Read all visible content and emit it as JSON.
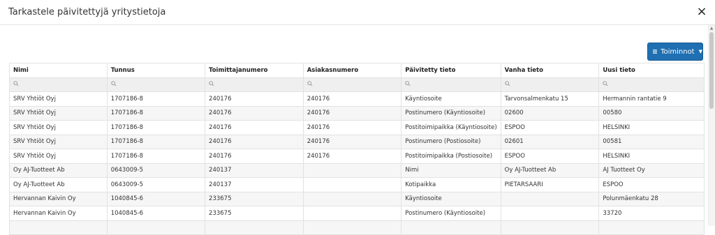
{
  "dialog": {
    "title": "Tarkastele päivitettyjä yritystietoja",
    "close_label": "×"
  },
  "toolbar": {
    "actions_label": "Toiminnot",
    "accent": "#1f6fb2"
  },
  "table": {
    "columns": [
      "Nimi",
      "Tunnus",
      "Toimittajanumero",
      "Asiakasnumero",
      "Päivitetty tieto",
      "Vanha tieto",
      "Uusi tieto"
    ],
    "rows": [
      [
        "SRV Yhtiöt Oyj",
        "1707186-8",
        "240176",
        "240176",
        "Käyntiosoite",
        "Tarvonsalmenkatu 15",
        "Hermannin rantatie 9"
      ],
      [
        "SRV Yhtiöt Oyj",
        "1707186-8",
        "240176",
        "240176",
        "Postinumero (Käyntiosoite)",
        "02600",
        "00580"
      ],
      [
        "SRV Yhtiöt Oyj",
        "1707186-8",
        "240176",
        "240176",
        "Postitoimipaikka (Käyntiosoite)",
        "ESPOO",
        "HELSINKI"
      ],
      [
        "SRV Yhtiöt Oyj",
        "1707186-8",
        "240176",
        "240176",
        "Postinumero (Postiosoite)",
        "02601",
        "00581"
      ],
      [
        "SRV Yhtiöt Oyj",
        "1707186-8",
        "240176",
        "240176",
        "Postitoimipaikka (Postiosoite)",
        "ESPOO",
        "HELSINKI"
      ],
      [
        "Oy AJ-Tuotteet Ab",
        "0643009-5",
        "240137",
        "",
        "Nimi",
        "Oy AJ-Tuotteet Ab",
        "AJ Tuotteet Oy"
      ],
      [
        "Oy AJ-Tuotteet Ab",
        "0643009-5",
        "240137",
        "",
        "Kotipaikka",
        "PIETARSAARI",
        "ESPOO"
      ],
      [
        "Hervannan Kaivin Oy",
        "1040845-6",
        "233675",
        "",
        "Käyntiosoite",
        "",
        "Polunmäenkatu 28"
      ],
      [
        "Hervannan Kaivin Oy",
        "1040845-6",
        "233675",
        "",
        "Postinumero (Käyntiosoite)",
        "",
        "33720"
      ],
      [
        "",
        "",
        "",
        "",
        "",
        "",
        ""
      ]
    ]
  }
}
